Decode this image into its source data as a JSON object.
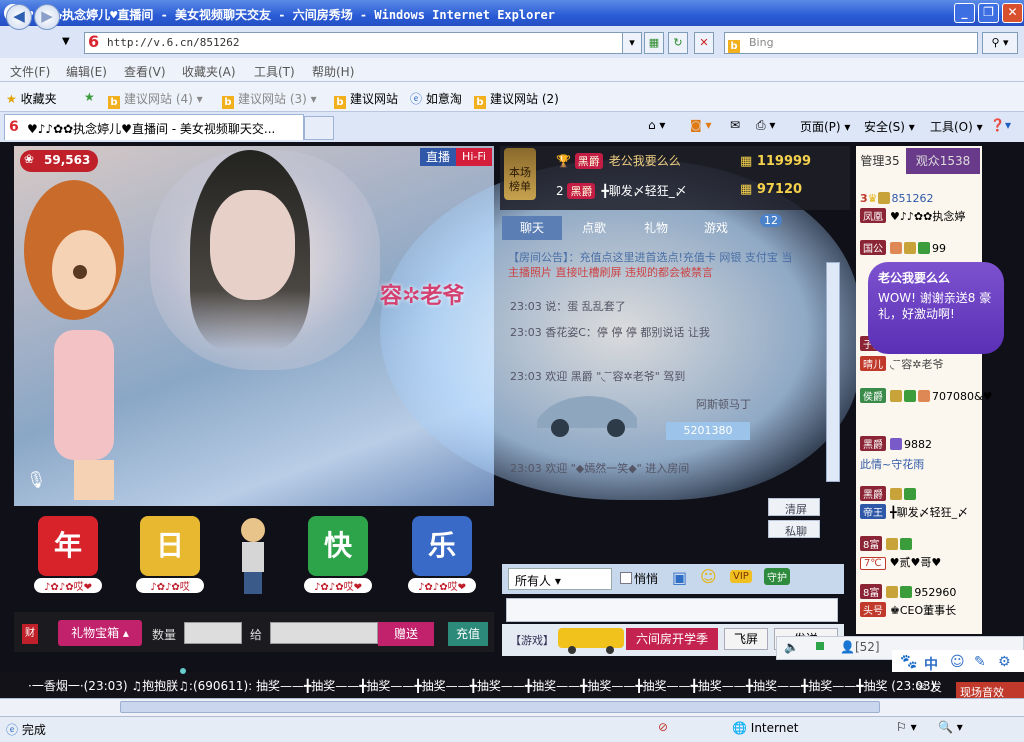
{
  "window": {
    "title": "♥♪♪✿✿执念婷儿♥直播间 - 美女视频聊天交友 - 六间房秀场 - Windows Internet Explorer"
  },
  "nav": {
    "url": "http://v.6.cn/851262",
    "search_placeholder": "Bing"
  },
  "menu": [
    "文件(F)",
    "编辑(E)",
    "查看(V)",
    "收藏夹(A)",
    "工具(T)",
    "帮助(H)"
  ],
  "favorites": {
    "label": "收藏夹",
    "items": [
      "建议网站",
      "(4)",
      "建议网站",
      "(3)",
      "建议网站",
      "如意淘",
      "建议网站",
      "(2)"
    ]
  },
  "tab": {
    "title": "♥♪♪✿✿执念婷儿♥直播间 - 美女视频聊天交..."
  },
  "commands": {
    "page": "页面(P)",
    "safety": "安全(S)",
    "tools": "工具(O)"
  },
  "video": {
    "flowers": "59,563",
    "live": "直播",
    "hifi": "Hi-Fi",
    "host": "容✲老爷"
  },
  "ranking": {
    "badge_l1": "本场",
    "badge_l2": "榜单",
    "rows": [
      {
        "rank": "1",
        "vip": "黑爵",
        "name": "老公我要么么",
        "coins": "119999"
      },
      {
        "rank": "2",
        "vip": "黑爵",
        "name": "╋聊发〆轻狂_〆",
        "coins": "97120"
      }
    ]
  },
  "chat": {
    "tabs": [
      "聊天",
      "点歌",
      "礼物",
      "游戏"
    ],
    "badge": "12",
    "announce": "【房间公告】：充值点这里进首选点!充值卡 网银 支付宝 当",
    "announce2": "主播照片 直接吐槽刷屏 违规的都会被禁言",
    "lines": [
      {
        "t": "23:03",
        "txt": "说：蛋 乱乱套了"
      },
      {
        "t": "23:03",
        "txt": "香花姿C：停 停 停 都别说话 让我"
      },
      {
        "t": "23:03",
        "txt": "欢迎 黑爵 \"◟ ̄ ̄容✲老爷\" 驾到"
      },
      {
        "t": "",
        "txt": "阿斯顿马丁"
      },
      {
        "t": "",
        "txt": "5201380"
      },
      {
        "t": "23:03",
        "txt": "欢迎 \"◆嫣然一笑◆\" 进入房间"
      }
    ],
    "clear": "清屏",
    "private": "私聊",
    "to": "所有人",
    "whisper": "悄悄",
    "send_label": "发送",
    "game": "【游戏】",
    "promo": "六间房开学季",
    "fly": "飞屏",
    "count": "[52]"
  },
  "users": {
    "tab_admin": "管理35",
    "tab_audience": "观众1538",
    "rows": [
      {
        "tag": "凤凰",
        "name": "851262",
        "name2": "♥♪♪✿✿执念婷"
      },
      {
        "tag": "国公",
        "name": "99"
      },
      {
        "tag": "子爵",
        "name": "晴儿"
      },
      {
        "tag": "侯爵",
        "name": "707080&♥"
      },
      {
        "tag": "黑爵",
        "name": "9882"
      },
      {
        "tag": "",
        "name": "此情~守花雨"
      },
      {
        "tag": "黑爵",
        "name": "╋聊发〆轻狂_〆"
      },
      {
        "tag": "帝王",
        "name": ""
      },
      {
        "tag": "8富",
        "name": "♥贰♥哥♥"
      },
      {
        "tag": "8富",
        "name": "952960"
      },
      {
        "tag": "头号",
        "name": "♚CEO董事长"
      }
    ]
  },
  "popup": {
    "title": "老公我要么么",
    "body": "WOW! 谢谢亲送8 豪礼，好激动啊!"
  },
  "gifts": [
    {
      "g": "年",
      "label": "♪✿♪✿哎❤"
    },
    {
      "g": "日",
      "label": "♪✿♪✿哎"
    },
    {
      "g": "快",
      "label": "♪✿♪✿哎❤"
    },
    {
      "g": "乐",
      "label": "♪✿♪✿哎❤"
    }
  ],
  "controls": {
    "giftbox": "礼物宝箱",
    "qty": "数量",
    "to": "给",
    "give": "赠送",
    "recharge": "充值"
  },
  "ticker": "·一香烟一·(23:03)   ♫抱抱朕♫:(690611):  抽奖——╋抽奖——╋抽奖——╋抽奖——╋抽奖——╋抽奖——╋抽奖——╋抽奖——╋抽奖——╋抽奖——╋抽奖——╋抽奖 (23:03)",
  "status": {
    "done": "完成",
    "zone": "Internet",
    "zoom": "",
    "task": "现场音效",
    "taskn": "1",
    "send": "发"
  }
}
